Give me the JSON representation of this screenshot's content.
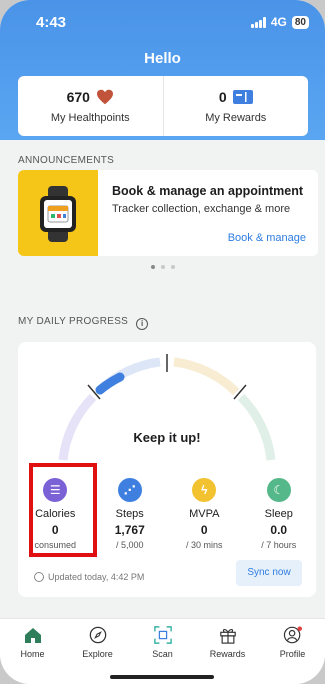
{
  "status": {
    "time": "4:43",
    "network": "4G",
    "battery": "80"
  },
  "header": {
    "title": "Hello"
  },
  "stats": {
    "healthpoints": {
      "value": "670",
      "label": "My Healthpoints",
      "icon": "heart-icon"
    },
    "rewards": {
      "value": "0",
      "label": "My Rewards",
      "icon": "ticket-icon"
    }
  },
  "announcements": {
    "section_title": "ANNOUNCEMENTS",
    "card": {
      "title": "Book & manage an appointment",
      "subtitle": "Tracker collection, exchange & more",
      "link": "Book & manage",
      "image": "smartwatch-icon"
    },
    "pager": {
      "count": 3,
      "active": 0
    }
  },
  "progress": {
    "section_title": "MY DAILY PROGRESS",
    "message": "Keep it up!",
    "metrics": [
      {
        "name": "Calories",
        "value": "0",
        "unit": "consumed",
        "icon": "calories-icon",
        "color": "#7b61d6"
      },
      {
        "name": "Steps",
        "value": "1,767",
        "unit": "/ 5,000",
        "icon": "steps-icon",
        "color": "#3f7fe0"
      },
      {
        "name": "MVPA",
        "value": "0",
        "unit": "/ 30 mins",
        "icon": "lightning-icon",
        "color": "#f2c230"
      },
      {
        "name": "Sleep",
        "value": "0.0",
        "unit": "/ 7 hours",
        "icon": "moon-icon",
        "color": "#55b88a"
      }
    ],
    "updated": "Updated today, 4:42 PM",
    "sync_label": "Sync now"
  },
  "tabs": [
    {
      "label": "Home",
      "icon": "home-icon",
      "active": true
    },
    {
      "label": "Explore",
      "icon": "compass-icon"
    },
    {
      "label": "Scan",
      "icon": "scan-icon"
    },
    {
      "label": "Rewards",
      "icon": "gift-icon"
    },
    {
      "label": "Profile",
      "icon": "profile-icon"
    }
  ],
  "colors": {
    "header": "#4a93e8",
    "accent": "#2f7de1",
    "highlight": "#e01010"
  }
}
